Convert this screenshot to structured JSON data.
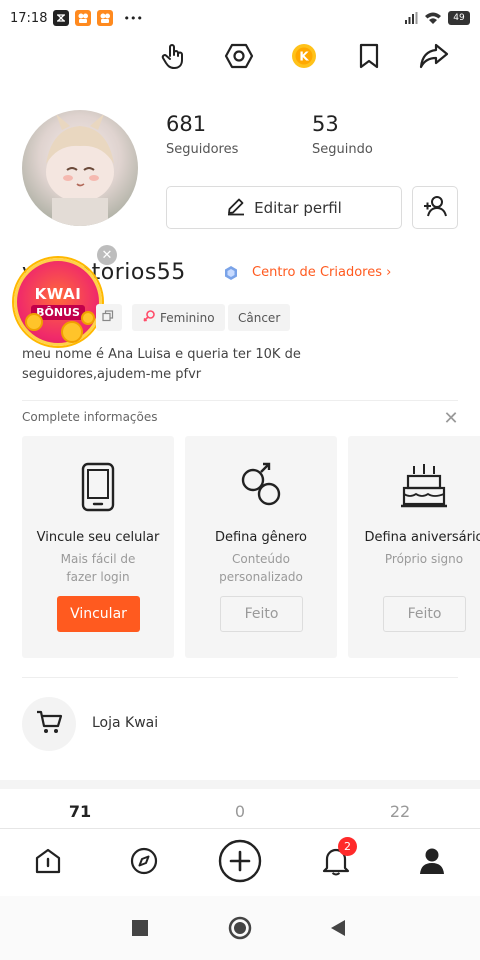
{
  "status_bar": {
    "time": "17:18",
    "more": "•••",
    "battery": "49"
  },
  "profile": {
    "followers_count": "681",
    "followers_label": "Seguidores",
    "following_count": "53",
    "following_label": "Seguindo",
    "edit_profile_label": "Editar perfil",
    "username": "v   aleatorios55",
    "creator_center_label": "Centro de Criadores",
    "bio": "meu nome é Ana Luisa e queria ter 10K de seguidores,ajudem-me pfvr"
  },
  "kwai_badge": {
    "line1": "KWAI",
    "line2": "BÔNUS",
    "close": "✕"
  },
  "tags": [
    {
      "label": "Feminino"
    },
    {
      "label": "Câncer"
    }
  ],
  "complete_info": {
    "title": "Complete informações",
    "close": "✕",
    "cards": [
      {
        "title": "Vincule seu celular",
        "subtitle": "Mais fácil de fazer login",
        "button": "Vincular",
        "icon": "phone-icon"
      },
      {
        "title": "Defina gênero",
        "subtitle": "Conteúdo personalizado",
        "button": "Feito",
        "icon": "gender-icon"
      },
      {
        "title": "Defina aniversário",
        "subtitle": "Próprio signo",
        "button": "Feito",
        "icon": "cake-icon"
      }
    ]
  },
  "shop": {
    "label": "Loja Kwai",
    "icon": "cart-icon"
  },
  "content_counts": [
    "71",
    "0",
    "22"
  ],
  "bottom_nav": {
    "items": [
      {
        "name": "home",
        "icon": "home-icon"
      },
      {
        "name": "discover",
        "icon": "compass-icon"
      },
      {
        "name": "create",
        "icon": "plus-icon"
      },
      {
        "name": "notifications",
        "icon": "bell-icon",
        "badge": "2"
      },
      {
        "name": "profile",
        "icon": "user-icon"
      }
    ]
  },
  "colors": {
    "accent": "#ff5a1f",
    "badge_red": "#ff2a2a"
  }
}
